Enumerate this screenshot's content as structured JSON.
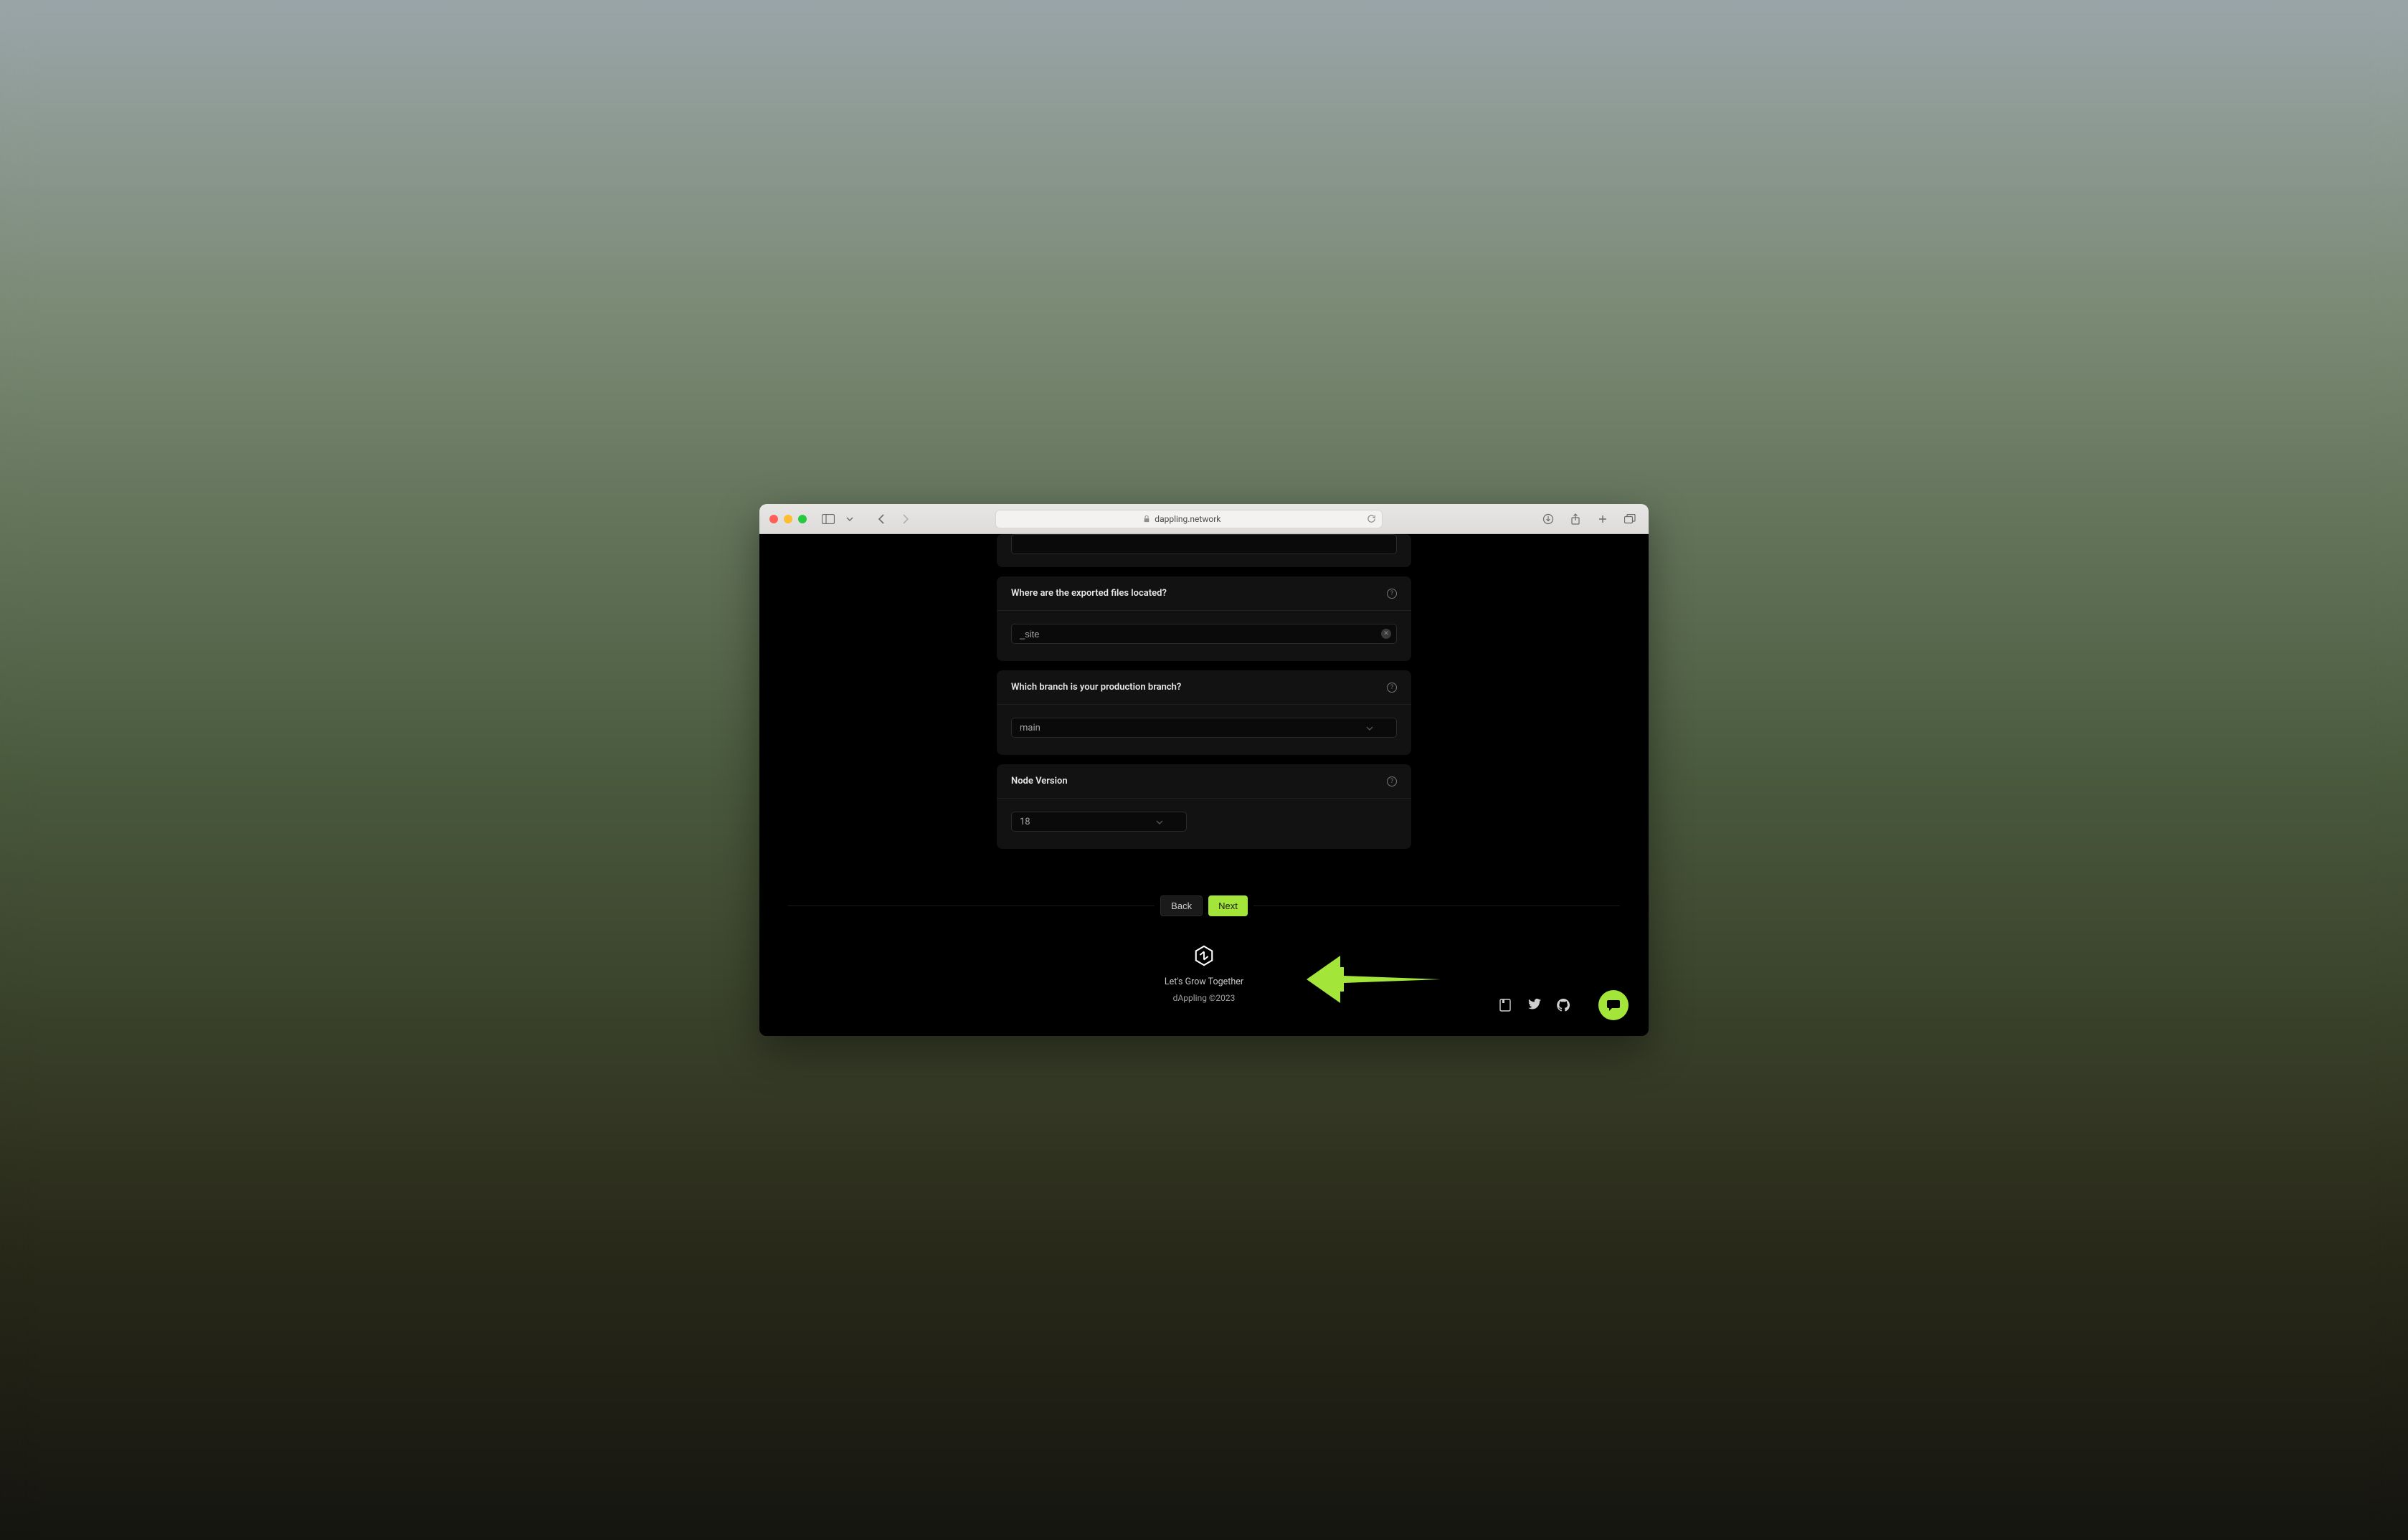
{
  "browser": {
    "url": "dappling.network"
  },
  "form": {
    "card_partial_input": "",
    "card_exported": {
      "title": "Where are the exported files located?",
      "value": "_site"
    },
    "card_branch": {
      "title": "Which branch is your production branch?",
      "value": "main"
    },
    "card_node": {
      "title": "Node Version",
      "value": "18"
    }
  },
  "actions": {
    "back": "Back",
    "next": "Next"
  },
  "footer": {
    "tagline": "Let's Grow Together",
    "copyright": "dAppling ©2023"
  },
  "colors": {
    "accent": "#a4e53a",
    "background": "#000000",
    "card": "#121212"
  }
}
